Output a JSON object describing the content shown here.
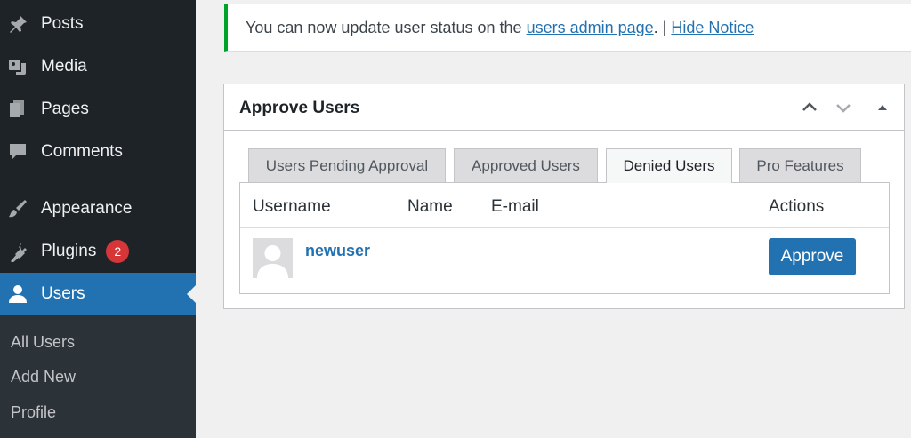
{
  "sidebar": {
    "items": [
      {
        "label": "Posts",
        "icon": "pin-icon"
      },
      {
        "label": "Media",
        "icon": "media-icon"
      },
      {
        "label": "Pages",
        "icon": "pages-icon"
      },
      {
        "label": "Comments",
        "icon": "comment-icon"
      },
      {
        "label": "Appearance",
        "icon": "brush-icon"
      },
      {
        "label": "Plugins",
        "icon": "plug-icon",
        "badge": "2"
      },
      {
        "label": "Users",
        "icon": "user-icon",
        "current": true
      }
    ],
    "submenu": [
      "All Users",
      "Add New",
      "Profile"
    ]
  },
  "notice": {
    "text_before": "You can now update user status on the ",
    "link": "users admin page",
    "text_between": ". | ",
    "hide_link": "Hide Notice"
  },
  "panel": {
    "title": "Approve Users",
    "tabs": [
      "Users Pending Approval",
      "Approved Users",
      "Denied Users",
      "Pro Features"
    ],
    "active_tab": "Denied Users",
    "columns": [
      "Username",
      "Name",
      "E-mail",
      "Actions"
    ],
    "rows": [
      {
        "username": "newuser",
        "name": "",
        "email": "",
        "action": "Approve"
      }
    ]
  },
  "colors": {
    "sidebar_bg": "#1d2327",
    "accent": "#2271b1",
    "notice_border": "#00a32a",
    "badge": "#d63638"
  }
}
